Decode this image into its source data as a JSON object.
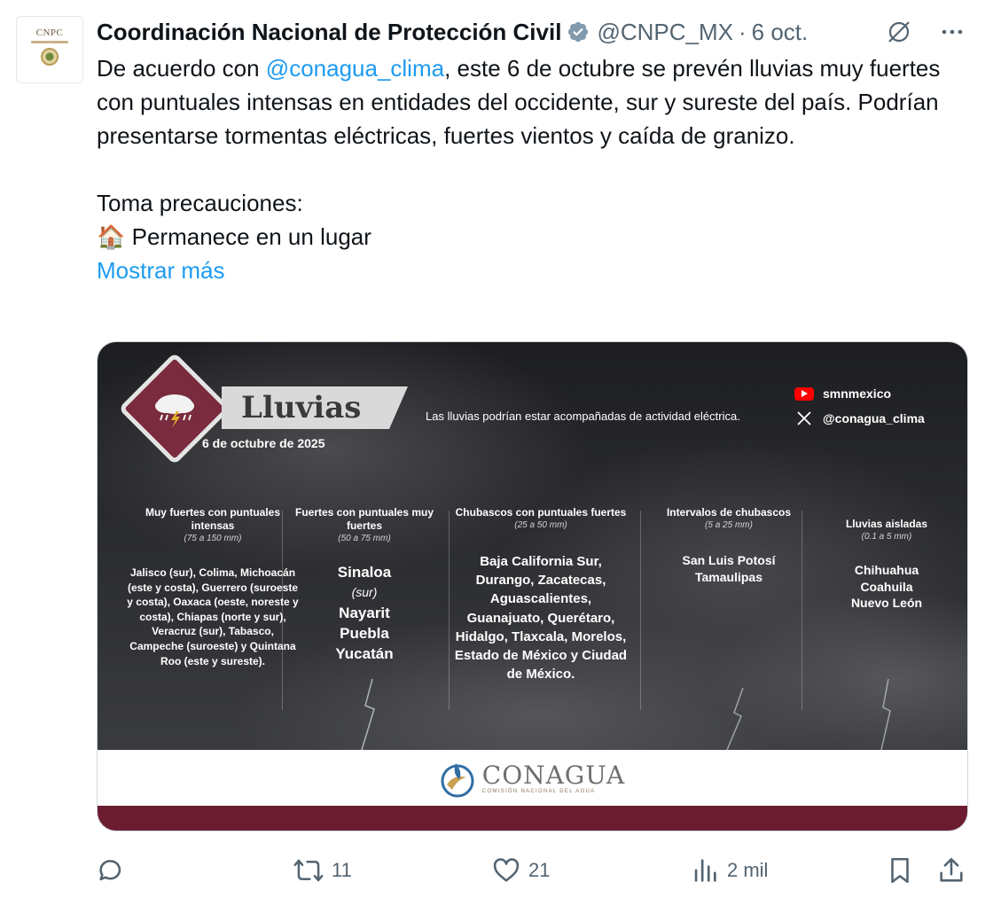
{
  "author": {
    "avatar_text": "CNPC",
    "display_name": "Coordinación Nacional de Protección Civil",
    "handle": "@CNPC_MX",
    "separator": "·",
    "date": "6 oct.",
    "verified_icon": "verified-badge-icon"
  },
  "tweet": {
    "line1_pre": "De acuerdo con ",
    "mention": "@conagua_clima",
    "line1_post": ", este 6 de octubre se prevén lluvias muy fuertes con puntuales intensas en entidades del occidente, sur y sureste del país. Podrían presentarse tormentas eléctricas, fuertes vientos y caída de granizo.",
    "precautions": "Toma precauciones:",
    "bullet_emoji": "🏠",
    "bullet_text": "Permanece en un lugar",
    "show_more": "Mostrar más"
  },
  "media": {
    "title": "Lluvias",
    "date": "6 de octubre de 2025",
    "note": "Las lluvias podrían estar acompañadas  de actividad eléctrica.",
    "social_youtube": "smnmexico",
    "social_x": "@conagua_clima",
    "columns": [
      {
        "heading": "Muy fuertes con puntuales intensas",
        "range": "(75 a 150 mm)",
        "body": "Jalisco (sur), Colima, Michoacán (este y costa), Guerrero (suroeste y costa), Oaxaca (oeste, noreste y costa), Chiapas (norte y sur), Veracruz (sur), Tabasco, Campeche (suroeste) y Quintana Roo (este y sureste)."
      },
      {
        "heading": "Fuertes con puntuales muy fuertes",
        "range": "(50 a 75 mm)",
        "line1": "Sinaloa",
        "line1_note": "(sur)",
        "line2": "Nayarit",
        "line3": "Puebla",
        "line4": "Yucatán"
      },
      {
        "heading": "Chubascos con puntuales fuertes",
        "range": "(25 a 50 mm)",
        "body": "Baja California Sur, Durango, Zacatecas, Aguascalientes, Guanajuato, Querétaro, Hidalgo, Tlaxcala, Morelos, Estado de México y Ciudad de México."
      },
      {
        "heading": "Intervalos de chubascos",
        "range": "(5 a 25 mm)",
        "line1": "San Luis Potosí",
        "line2": "Tamaulipas"
      },
      {
        "heading": "Lluvias aisladas",
        "range": "(0.1 a 5 mm)",
        "line1": "Chihuahua",
        "line2": "Coahuila",
        "line3": "Nuevo León"
      }
    ],
    "footer_logo": "CONAGUA",
    "footer_sub": "COMISIÓN NACIONAL DEL AGUA"
  },
  "actions": {
    "reply_count": "",
    "retweet_count": "11",
    "like_count": "21",
    "views_count": "2 mil"
  },
  "colors": {
    "accent": "#1d9bf0",
    "text": "#0f1419",
    "muted": "#536471",
    "wine": "#6b1c30"
  }
}
